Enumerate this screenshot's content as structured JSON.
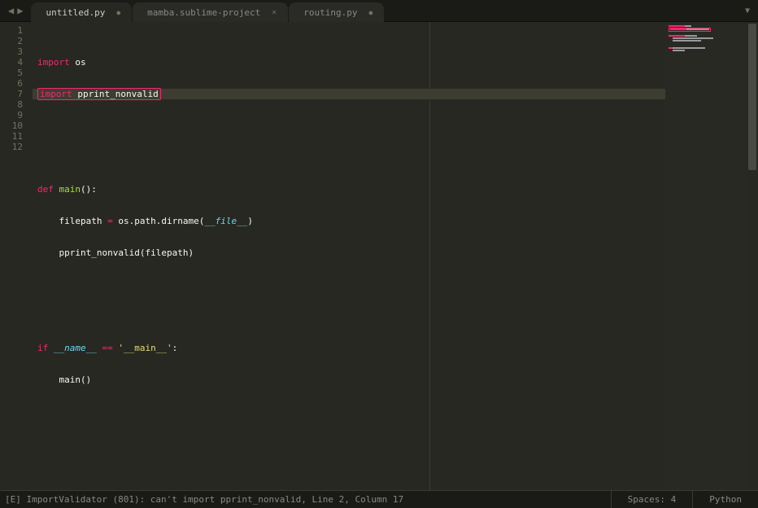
{
  "tabs": [
    {
      "label": "untitled.py",
      "dirty": true,
      "active": true
    },
    {
      "label": "mamba.sublime-project",
      "dirty": false,
      "active": false
    },
    {
      "label": "routing.py",
      "dirty": true,
      "active": false
    }
  ],
  "gutter_max": 12,
  "error_line": 2,
  "code": {
    "l1": {
      "kw1": "import",
      "mod": "os"
    },
    "l2": {
      "kw1": "import",
      "mod": "pprint_nonvalid"
    },
    "l5": {
      "kw1": "def",
      "name": "main",
      "p": "():"
    },
    "l6": {
      "indent": "    ",
      "var": "filepath",
      "op": " = ",
      "call": "os.path.dirname(",
      "arg": "__file__",
      "end": ")"
    },
    "l7": {
      "indent": "    ",
      "call": "pprint_nonvalid(filepath)"
    },
    "l10": {
      "kw1": "if",
      "var": "__name__",
      "op": " == ",
      "str": "'__main__'",
      "end": ":"
    },
    "l11": {
      "indent": "    ",
      "call": "main()"
    }
  },
  "status": {
    "message": "[E] ImportValidator (801): can't import pprint_nonvalid, Line 2, Column 17",
    "spaces": "Spaces: 4",
    "syntax": "Python"
  }
}
